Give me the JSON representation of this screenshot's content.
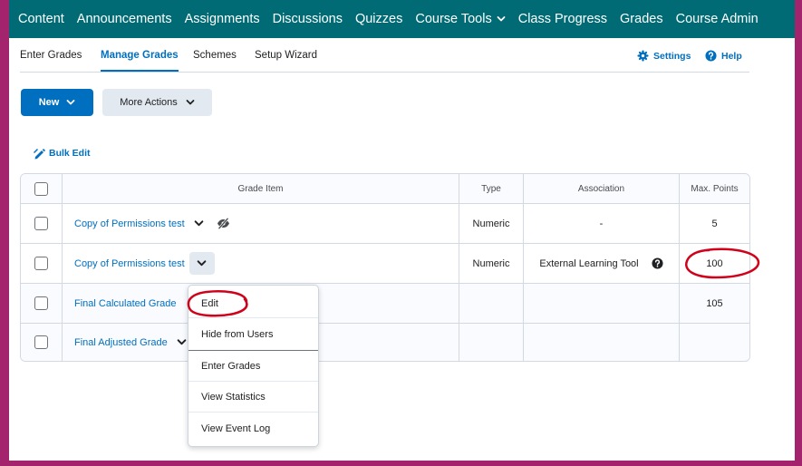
{
  "nav": {
    "items": [
      {
        "label": "Content"
      },
      {
        "label": "Announcements"
      },
      {
        "label": "Assignments"
      },
      {
        "label": "Discussions"
      },
      {
        "label": "Quizzes"
      },
      {
        "label": "Course Tools",
        "icon": "chevron-down-icon"
      },
      {
        "label": "Class Progress"
      },
      {
        "label": "Grades"
      },
      {
        "label": "Course Admin"
      }
    ]
  },
  "tabs": [
    {
      "label": "Enter Grades"
    },
    {
      "label": "Manage Grades",
      "active": true
    },
    {
      "label": "Schemes"
    },
    {
      "label": "Setup Wizard"
    }
  ],
  "utilities": {
    "settings_label": "Settings",
    "help_label": "Help"
  },
  "toolbar": {
    "new_label": "New",
    "more_actions_label": "More Actions",
    "bulk_edit_label": "Bulk Edit"
  },
  "table": {
    "headers": {
      "grade_item": "Grade Item",
      "type": "Type",
      "association": "Association",
      "max_points": "Max. Points"
    },
    "rows": [
      {
        "name": "Copy of Permissions test",
        "type": "Numeric",
        "association": "-",
        "max_points": "5",
        "hidden": true
      },
      {
        "name": "Copy of Permissions test",
        "type": "Numeric",
        "association": "External Learning Tool",
        "max_points": "100"
      },
      {
        "name": "Final Calculated Grade",
        "type": "",
        "association": "",
        "max_points": "105"
      },
      {
        "name": "Final Adjusted Grade",
        "type": "",
        "association": "",
        "max_points": ""
      }
    ]
  },
  "context_menu": {
    "items": [
      {
        "label": "Edit"
      },
      {
        "label": "Hide from Users"
      },
      {
        "label": "Enter Grades"
      },
      {
        "label": "View Statistics"
      },
      {
        "label": "View Event Log"
      }
    ]
  },
  "colors": {
    "nav_bg": "#006b75",
    "accent": "#006fbf",
    "annotation": "#d0021b",
    "frame": "#a3246d"
  }
}
